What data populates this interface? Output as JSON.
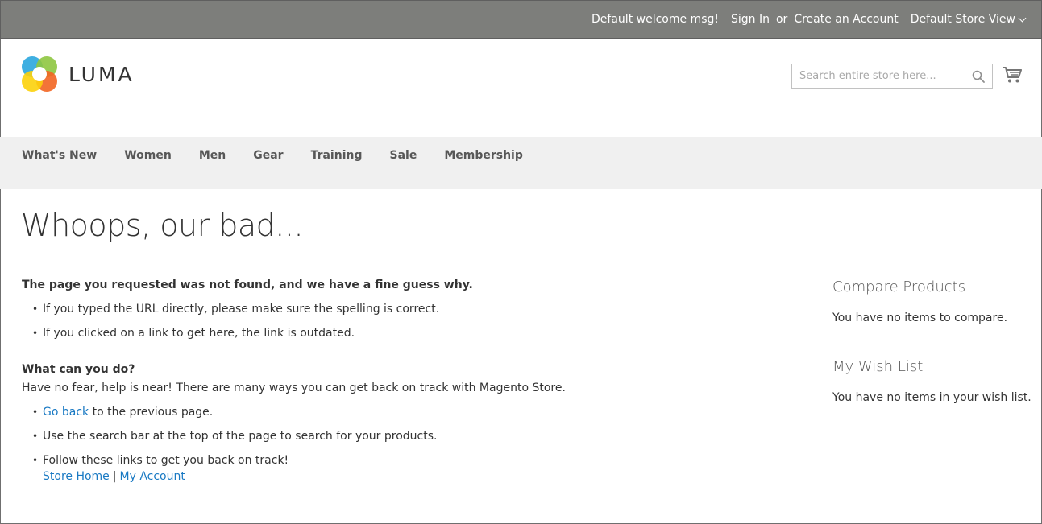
{
  "topbar": {
    "welcome": "Default welcome msg!",
    "sign_in": "Sign In",
    "or": "or",
    "create_account": "Create an Account",
    "store_view": "Default Store View"
  },
  "header": {
    "logo_text": "LUMA",
    "search_placeholder": "Search entire store here...",
    "search_value": ""
  },
  "nav": {
    "items": [
      "What's New",
      "Women",
      "Men",
      "Gear",
      "Training",
      "Sale",
      "Membership"
    ]
  },
  "main": {
    "title": "Whoops, our bad...",
    "block1": {
      "heading": "The page you requested was not found, and we have a fine guess why.",
      "items": [
        "If you typed the URL directly, please make sure the spelling is correct.",
        "If you clicked on a link to get here, the link is outdated."
      ]
    },
    "block2": {
      "heading": "What can you do?",
      "intro": "Have no fear, help is near! There are many ways you can get back on track with Magento Store.",
      "go_back_link": "Go back",
      "go_back_rest": " to the previous page.",
      "search_item": "Use the search bar at the top of the page to search for your products.",
      "follow_item": "Follow these links to get you back on track!",
      "store_home_link": "Store Home",
      "separator": "|",
      "my_account_link": "My Account"
    }
  },
  "sidebar": {
    "compare_title": "Compare Products",
    "compare_empty": "You have no items to compare.",
    "wishlist_title": "My Wish List",
    "wishlist_empty": "You have no items in your wish list."
  },
  "colors": {
    "topbar_bg": "#7d7e7b",
    "nav_bg": "#f0f0f0",
    "link": "#1979c3",
    "text": "#333333"
  }
}
